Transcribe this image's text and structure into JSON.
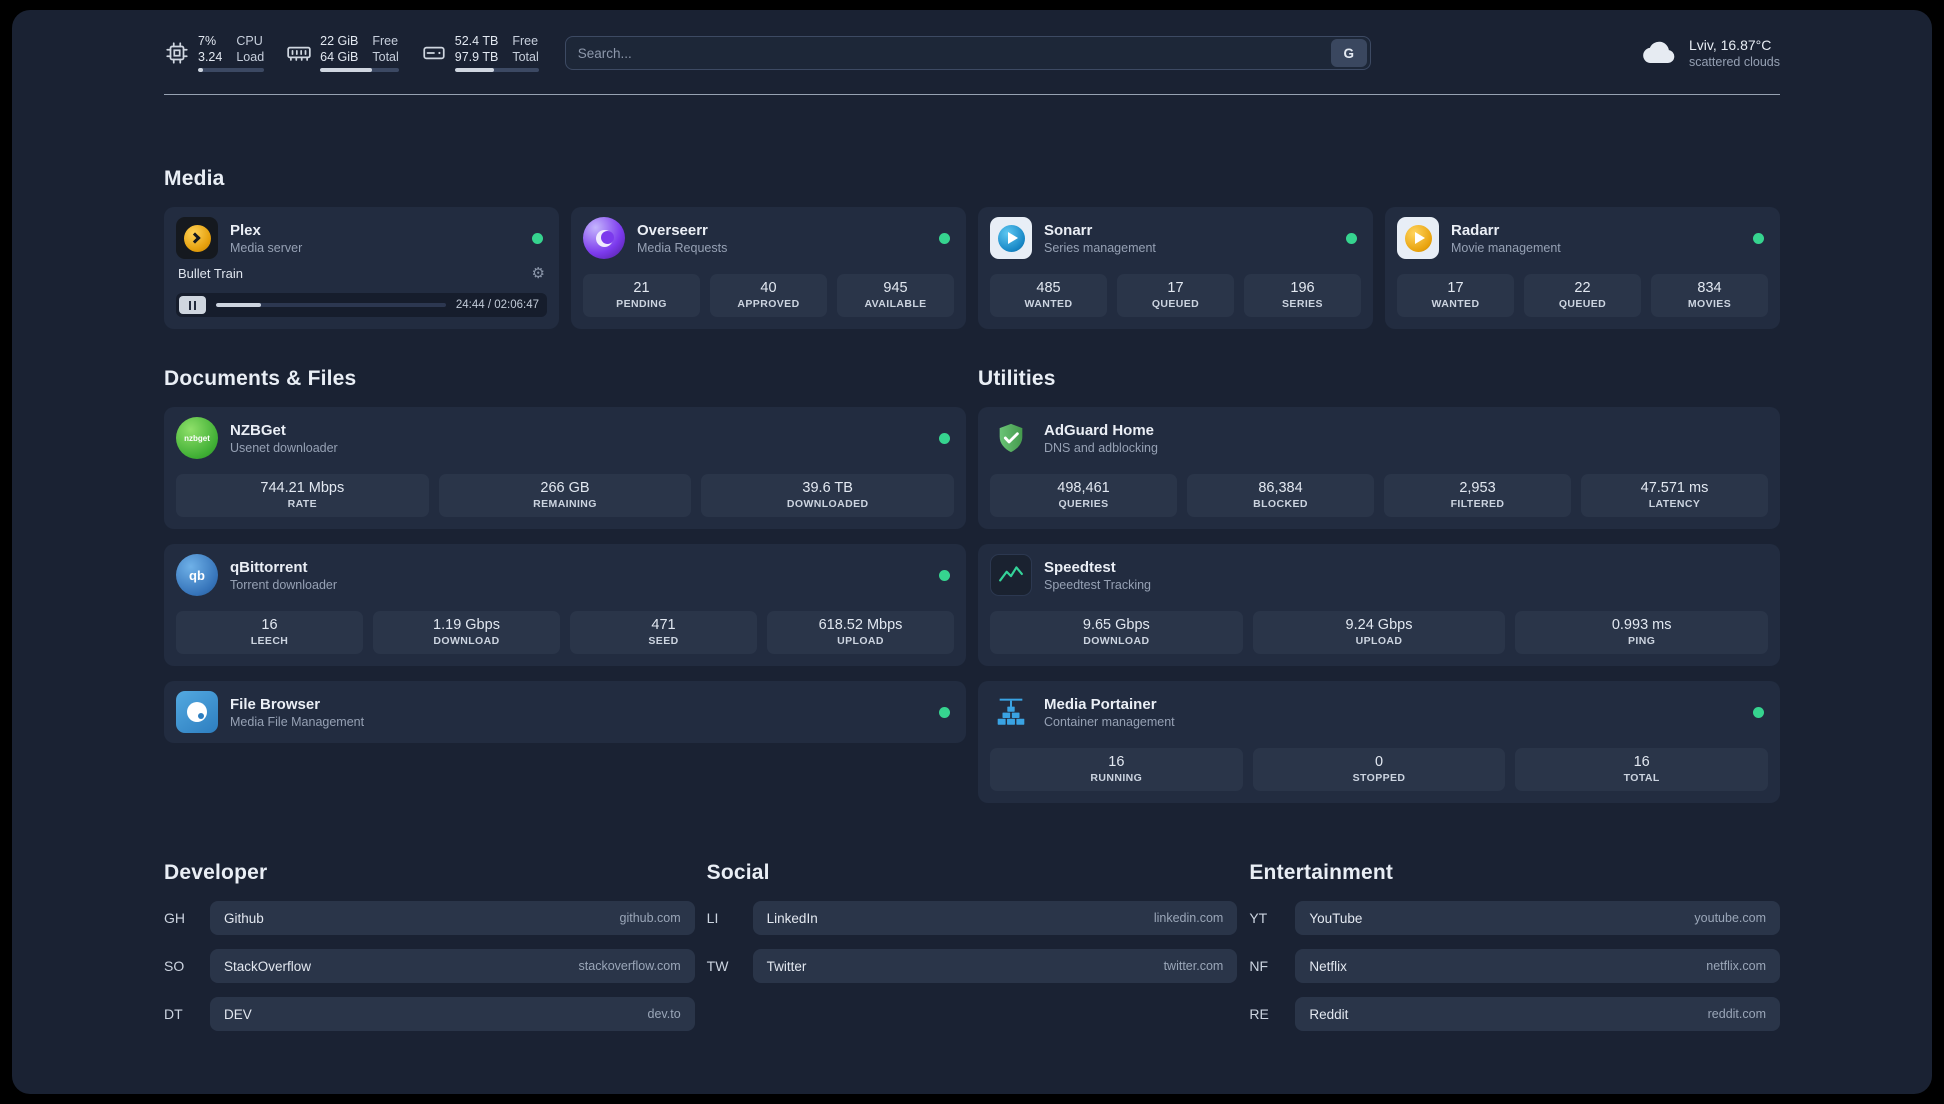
{
  "colors": {
    "background": "#1a2233",
    "card": "#222c40",
    "tile": "#2a3549",
    "status_online": "#36d48f",
    "divider": "#aeb9c9"
  },
  "topbar": {
    "cpu": {
      "value": "7%",
      "load": "3.24",
      "label_top": "CPU",
      "label_bottom": "Load",
      "percent": 7
    },
    "memory": {
      "free": "22 GiB",
      "total": "64 GiB",
      "label_top": "Free",
      "label_bottom": "Total",
      "percent": 65.6
    },
    "disk": {
      "free": "52.4 TB",
      "total": "97.9 TB",
      "label_top": "Free",
      "label_bottom": "Total",
      "percent": 46.5
    },
    "search": {
      "placeholder": "Search...",
      "button_label": "G"
    },
    "weather": {
      "location": "Lviv, 16.87°C",
      "condition": "scattered clouds"
    }
  },
  "media": {
    "title": "Media",
    "services": [
      {
        "name": "Plex",
        "subtitle": "Media server",
        "online": true,
        "player": {
          "track": "Bullet Train",
          "time": "24:44 / 02:06:47",
          "percent": 19.5
        }
      },
      {
        "name": "Overseerr",
        "subtitle": "Media Requests",
        "online": true,
        "stats": [
          {
            "value": "21",
            "label": "PENDING"
          },
          {
            "value": "40",
            "label": "APPROVED"
          },
          {
            "value": "945",
            "label": "AVAILABLE"
          }
        ]
      },
      {
        "name": "Sonarr",
        "subtitle": "Series management",
        "online": true,
        "stats": [
          {
            "value": "485",
            "label": "WANTED"
          },
          {
            "value": "17",
            "label": "QUEUED"
          },
          {
            "value": "196",
            "label": "SERIES"
          }
        ]
      },
      {
        "name": "Radarr",
        "subtitle": "Movie management",
        "online": true,
        "stats": [
          {
            "value": "17",
            "label": "WANTED"
          },
          {
            "value": "22",
            "label": "QUEUED"
          },
          {
            "value": "834",
            "label": "MOVIES"
          }
        ]
      }
    ]
  },
  "documents": {
    "title": "Documents & Files",
    "services": [
      {
        "name": "NZBGet",
        "subtitle": "Usenet downloader",
        "online": true,
        "stats": [
          {
            "value": "744.21 Mbps",
            "label": "RATE"
          },
          {
            "value": "266 GB",
            "label": "REMAINING"
          },
          {
            "value": "39.6 TB",
            "label": "DOWNLOADED"
          }
        ]
      },
      {
        "name": "qBittorrent",
        "subtitle": "Torrent downloader",
        "online": true,
        "stats": [
          {
            "value": "16",
            "label": "LEECH"
          },
          {
            "value": "1.19 Gbps",
            "label": "DOWNLOAD"
          },
          {
            "value": "471",
            "label": "SEED"
          },
          {
            "value": "618.52 Mbps",
            "label": "UPLOAD"
          }
        ]
      },
      {
        "name": "File Browser",
        "subtitle": "Media File Management",
        "online": true
      }
    ]
  },
  "utilities": {
    "title": "Utilities",
    "services": [
      {
        "name": "AdGuard Home",
        "subtitle": "DNS and adblocking",
        "stats": [
          {
            "value": "498,461",
            "label": "QUERIES"
          },
          {
            "value": "86,384",
            "label": "BLOCKED"
          },
          {
            "value": "2,953",
            "label": "FILTERED"
          },
          {
            "value": "47.571 ms",
            "label": "LATENCY"
          }
        ]
      },
      {
        "name": "Speedtest",
        "subtitle": "Speedtest Tracking",
        "stats": [
          {
            "value": "9.65 Gbps",
            "label": "DOWNLOAD"
          },
          {
            "value": "9.24 Gbps",
            "label": "UPLOAD"
          },
          {
            "value": "0.993 ms",
            "label": "PING"
          }
        ]
      },
      {
        "name": "Media Portainer",
        "subtitle": "Container management",
        "online": true,
        "stats": [
          {
            "value": "16",
            "label": "RUNNING"
          },
          {
            "value": "0",
            "label": "STOPPED"
          },
          {
            "value": "16",
            "label": "TOTAL"
          }
        ]
      }
    ]
  },
  "bookmarks": [
    {
      "title": "Developer",
      "items": [
        {
          "abbr": "GH",
          "name": "Github",
          "domain": "github.com"
        },
        {
          "abbr": "SO",
          "name": "StackOverflow",
          "domain": "stackoverflow.com"
        },
        {
          "abbr": "DT",
          "name": "DEV",
          "domain": "dev.to"
        }
      ]
    },
    {
      "title": "Social",
      "items": [
        {
          "abbr": "LI",
          "name": "LinkedIn",
          "domain": "linkedin.com"
        },
        {
          "abbr": "TW",
          "name": "Twitter",
          "domain": "twitter.com"
        }
      ]
    },
    {
      "title": "Entertainment",
      "items": [
        {
          "abbr": "YT",
          "name": "YouTube",
          "domain": "youtube.com"
        },
        {
          "abbr": "NF",
          "name": "Netflix",
          "domain": "netflix.com"
        },
        {
          "abbr": "RE",
          "name": "Reddit",
          "domain": "reddit.com"
        }
      ]
    }
  ],
  "icons": {
    "gear": "⚙",
    "nzbget_label": "nzbget",
    "qbittorrent_label": "qb"
  }
}
